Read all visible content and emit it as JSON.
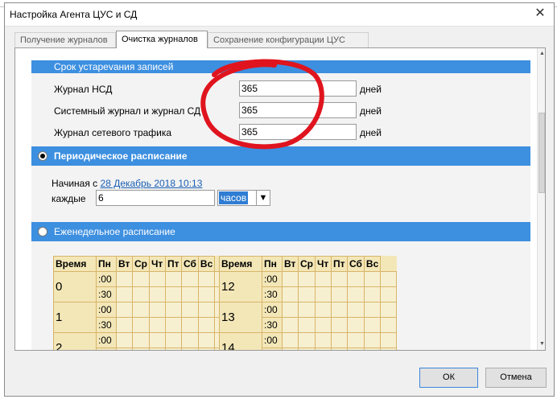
{
  "window": {
    "title": "Настройка Агента ЦУС и СД"
  },
  "tabs": [
    {
      "label": "Получение журналов"
    },
    {
      "label": "Очистка журналов"
    },
    {
      "label": "Сохранение конфигурации ЦУС"
    }
  ],
  "retention": {
    "header": "Срок устарevания записей",
    "rows": [
      {
        "label": "Журнал НСД",
        "value": "365",
        "unit": "дней"
      },
      {
        "label": "Системный журнал и журнал СД",
        "value": "365",
        "unit": "дней"
      },
      {
        "label": "Журнал сетевого трафика",
        "value": "365",
        "unit": "дней"
      }
    ]
  },
  "periodic": {
    "header": "Периодическое расписание",
    "selected": true,
    "start_prefix": "Начиная с",
    "start_link": "28 Декабрь 2018 10:13",
    "every_label": "каждые",
    "every_value": "6",
    "unit_value": "часов",
    "arrow": "▼"
  },
  "weekly": {
    "header": "Еженедельное расписание",
    "selected": false,
    "headers": [
      "Время",
      "Пн",
      "Вт",
      "Ср",
      "Чт",
      "Пт",
      "Сб",
      "Вс"
    ],
    "left_hours": [
      "0",
      "1",
      "2"
    ],
    "right_hours": [
      "12",
      "13",
      "14"
    ],
    "minutes": [
      ":00",
      ":30"
    ]
  },
  "buttons": {
    "ok": "ОК",
    "cancel": "Отмена"
  },
  "colors": {
    "accent": "#3d8fe0",
    "grid": "#f3e7b8",
    "annotation": "#e0141e"
  }
}
